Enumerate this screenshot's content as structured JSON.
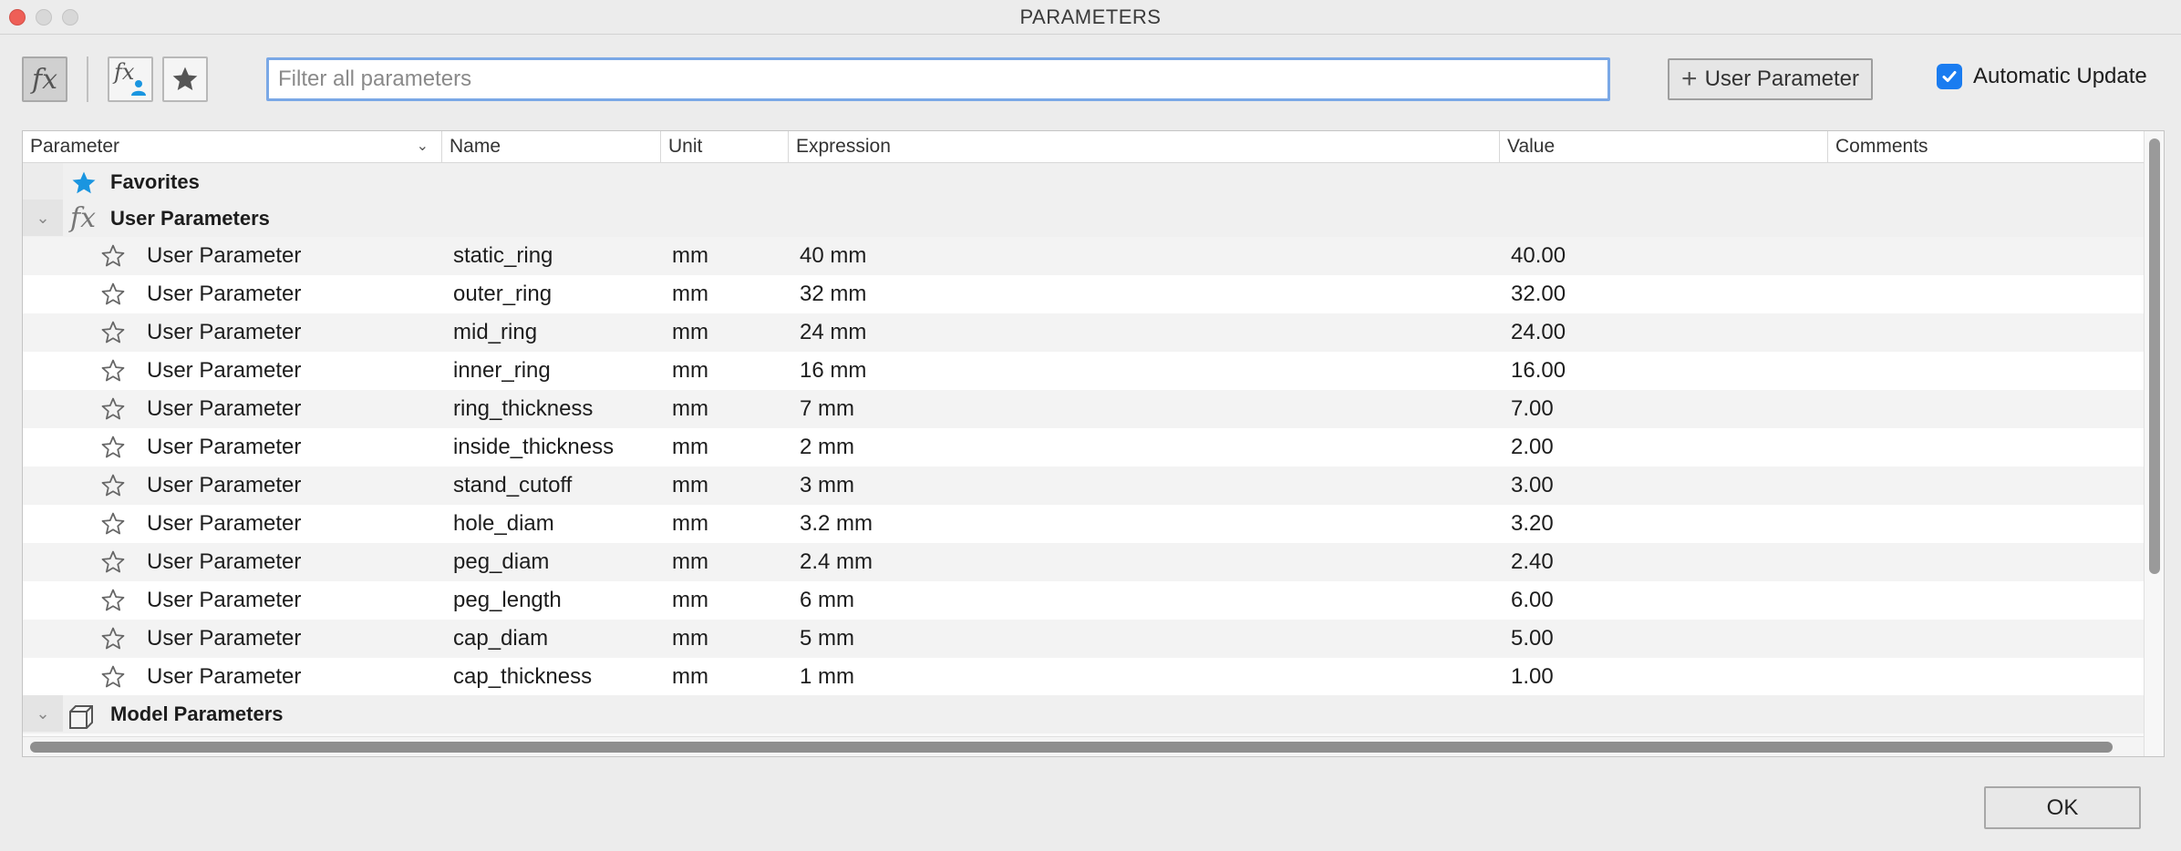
{
  "window": {
    "title": "PARAMETERS"
  },
  "toolbar": {
    "fx_glyph": "fx",
    "filter_placeholder": "Filter all parameters",
    "add_user_parameter_label": "User Parameter",
    "automatic_update_label": "Automatic Update",
    "automatic_update_checked": true
  },
  "table": {
    "headers": {
      "parameter": "Parameter",
      "name": "Name",
      "unit": "Unit",
      "expression": "Expression",
      "value": "Value",
      "comments": "Comments"
    },
    "groups": {
      "favorites": "Favorites",
      "user_parameters": "User Parameters",
      "model_parameters": "Model Parameters"
    },
    "rows": [
      {
        "parameter": "User Parameter",
        "name": "static_ring",
        "unit": "mm",
        "expression": "40 mm",
        "value": "40.00",
        "comments": ""
      },
      {
        "parameter": "User Parameter",
        "name": "outer_ring",
        "unit": "mm",
        "expression": "32 mm",
        "value": "32.00",
        "comments": ""
      },
      {
        "parameter": "User Parameter",
        "name": "mid_ring",
        "unit": "mm",
        "expression": "24 mm",
        "value": "24.00",
        "comments": ""
      },
      {
        "parameter": "User Parameter",
        "name": "inner_ring",
        "unit": "mm",
        "expression": "16 mm",
        "value": "16.00",
        "comments": ""
      },
      {
        "parameter": "User Parameter",
        "name": "ring_thickness",
        "unit": "mm",
        "expression": "7 mm",
        "value": "7.00",
        "comments": ""
      },
      {
        "parameter": "User Parameter",
        "name": "inside_thickness",
        "unit": "mm",
        "expression": "2 mm",
        "value": "2.00",
        "comments": ""
      },
      {
        "parameter": "User Parameter",
        "name": "stand_cutoff",
        "unit": "mm",
        "expression": "3 mm",
        "value": "3.00",
        "comments": ""
      },
      {
        "parameter": "User Parameter",
        "name": "hole_diam",
        "unit": "mm",
        "expression": "3.2 mm",
        "value": "3.20",
        "comments": ""
      },
      {
        "parameter": "User Parameter",
        "name": "peg_diam",
        "unit": "mm",
        "expression": "2.4 mm",
        "value": "2.40",
        "comments": ""
      },
      {
        "parameter": "User Parameter",
        "name": "peg_length",
        "unit": "mm",
        "expression": "6 mm",
        "value": "6.00",
        "comments": ""
      },
      {
        "parameter": "User Parameter",
        "name": "cap_diam",
        "unit": "mm",
        "expression": "5 mm",
        "value": "5.00",
        "comments": ""
      },
      {
        "parameter": "User Parameter",
        "name": "cap_thickness",
        "unit": "mm",
        "expression": "1 mm",
        "value": "1.00",
        "comments": ""
      }
    ]
  },
  "footer": {
    "ok_label": "OK"
  },
  "colors": {
    "accent": "#1a7cf0",
    "favorite_star": "#1a95e0",
    "close": "#ee5f57"
  }
}
